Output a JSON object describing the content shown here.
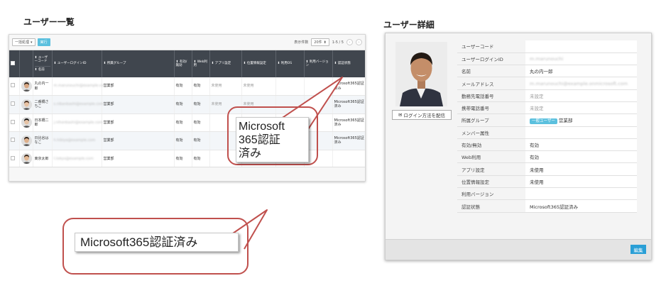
{
  "titles": {
    "list": "ユーザー一覧",
    "detail": "ユーザー詳細"
  },
  "list": {
    "toolbar": {
      "bulk_select": "一括処理",
      "run_label": "実行",
      "display_count_label": "表示件数",
      "per_page": "20件",
      "range": "1-5 / 5"
    },
    "columns": {
      "user_code": "ユーザーコード",
      "name": "名前",
      "login_id": "ユーザーログインID",
      "group": "所属グループ",
      "enabled": "有効/無効",
      "web": "Web利用",
      "app": "アプリ設定",
      "location": "位置情報設定",
      "os": "利用OS",
      "version": "利用バージョン",
      "auth": "認証状態"
    },
    "rows": [
      {
        "name": "丸の内一郎",
        "login": "m.marunouchi@example.com",
        "group": "営業部",
        "enabled": "有効",
        "web": "有効",
        "app": "未使用",
        "loc": "未使用",
        "auth": "Microsoft365認証済み"
      },
      {
        "name": "二番橋さちこ",
        "login": "s.nibanbashi@example.com",
        "group": "営業部",
        "enabled": "有効",
        "web": "有効",
        "app": "未使用",
        "loc": "未使用",
        "auth": "Microsoft365認証済み"
      },
      {
        "name": "日本橋二郎",
        "login": "j.nihonbashi@example.com",
        "group": "営業部",
        "enabled": "有効",
        "web": "有効",
        "app": "",
        "loc": "",
        "auth": "Microsoft365認証済み"
      },
      {
        "name": "日比谷はなこ",
        "login": "h.hibiya@example.com",
        "group": "営業部",
        "enabled": "有効",
        "web": "有効",
        "app": "",
        "loc": "",
        "auth": "Microsoft365認証済み"
      },
      {
        "name": "東京太郎",
        "login": "t.tokyo@example.com",
        "group": "営業部",
        "enabled": "有効",
        "web": "有効",
        "app": "",
        "loc": "",
        "auth": ""
      }
    ]
  },
  "callouts": {
    "large": "Microsoft\n365認証\n済み",
    "wide": "Microsoft365認証済み"
  },
  "detail": {
    "login_method_button": "ログイン方法を配信",
    "edit_button": "編集",
    "group_badge": "一般ユーザー",
    "fields": [
      {
        "label": "ユーザーコード",
        "value": ""
      },
      {
        "label": "ユーザーログインID",
        "value": "m.marunouchi",
        "blurred": true
      },
      {
        "label": "名前",
        "value": "丸の内一郎"
      },
      {
        "label": "メールアドレス",
        "value": "m.marunouchi@example.onmicrosoft.com",
        "blurred": true
      },
      {
        "label": "勤務先電話番号",
        "value": "未設定",
        "grey": true
      },
      {
        "label": "携帯電話番号",
        "value": "未設定",
        "grey": true
      },
      {
        "label": "所属グループ",
        "value": "営業部",
        "badge": true
      },
      {
        "label": "メンバー属性",
        "value": ""
      },
      {
        "label": "有効/無効",
        "value": "有効"
      },
      {
        "label": "Web利用",
        "value": "有効"
      },
      {
        "label": "アプリ設定",
        "value": "未使用"
      },
      {
        "label": "位置情報設定",
        "value": "未使用"
      },
      {
        "label": "利用バージョン",
        "value": ""
      },
      {
        "label": "認証状態",
        "value": "Microsoft365認証済み"
      }
    ]
  },
  "colors": {
    "accent": "#5bc0de",
    "edit": "#2a9fd6",
    "callout_border": "#c0504d",
    "table_header": "#40464e"
  }
}
